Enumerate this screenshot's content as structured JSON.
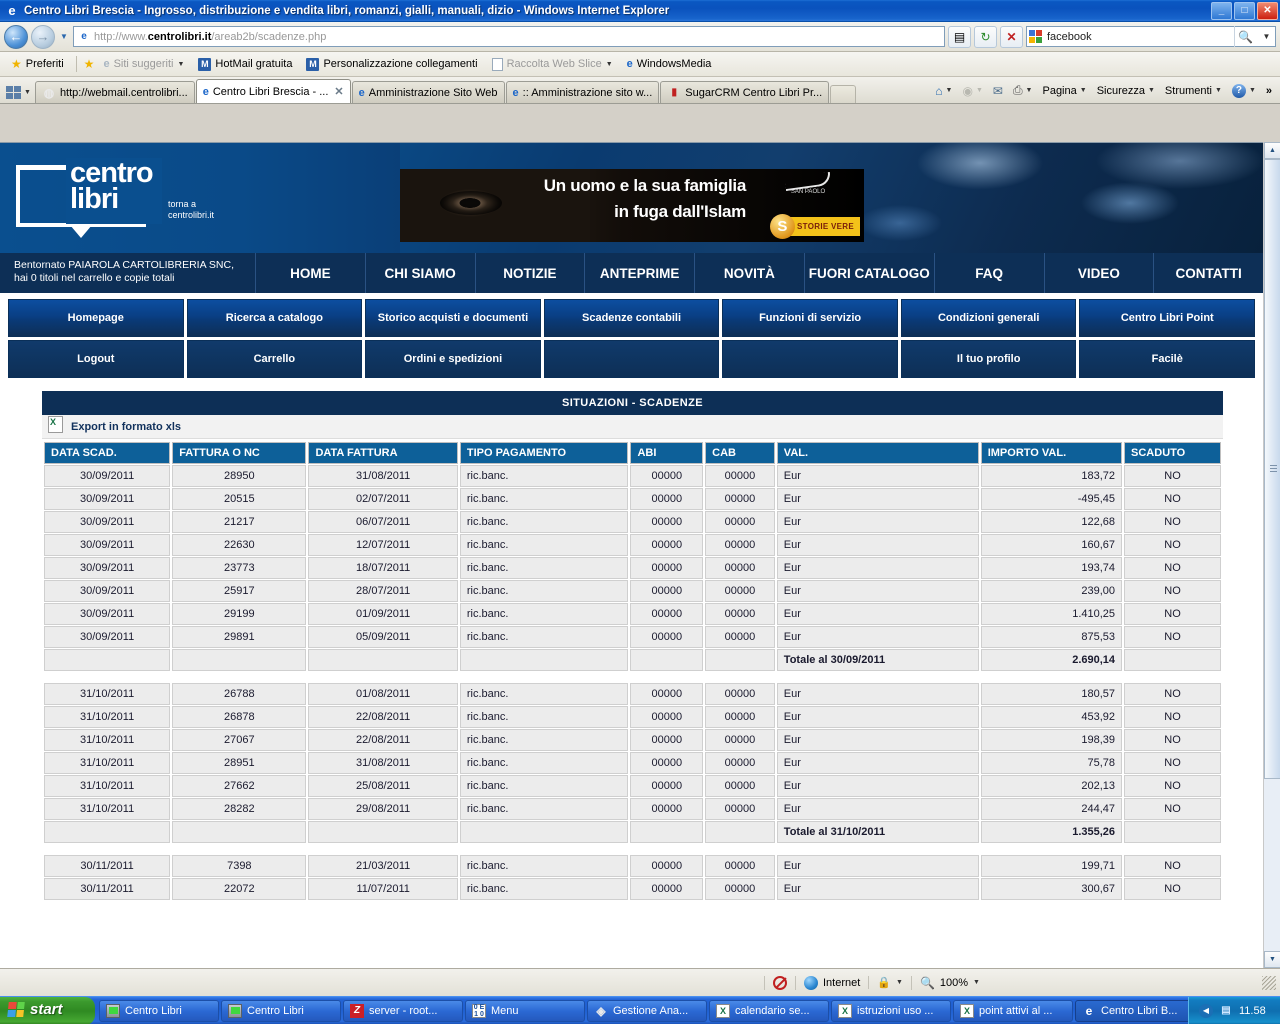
{
  "window": {
    "title": "Centro Libri Brescia - Ingrosso, distribuzione e vendita libri, romanzi, gialli, manuali, dizio - Windows Internet Explorer",
    "minimize_label": "_",
    "maximize_label": "□",
    "close_label": "✕"
  },
  "address_bar": {
    "back_icon": "back-arrow-icon",
    "forward_icon": "forward-arrow-icon",
    "url_prefix": "http://www.",
    "url_domain": "centrolibri.it",
    "url_suffix": "/areab2b/scadenze.php",
    "compat_icon": "compatibility-view-icon",
    "refresh_icon": "refresh-icon",
    "stop_icon": "stop-icon",
    "search_value": "facebook",
    "search_engine_icon": "google-icon",
    "search_go_icon": "search-icon"
  },
  "favorites_bar": {
    "favorites_label": "Preferiti",
    "items": [
      {
        "label": "Siti suggeriti",
        "icon": "ie-icon",
        "dropdown": true,
        "dimmed": true
      },
      {
        "label": "HotMail gratuita",
        "icon": "msn-icon",
        "dropdown": false,
        "dimmed": false
      },
      {
        "label": "Personalizzazione collegamenti",
        "icon": "msn-icon",
        "dropdown": false,
        "dimmed": false
      },
      {
        "label": "Raccolta Web Slice",
        "icon": "webslice-icon",
        "dropdown": true,
        "dimmed": true
      },
      {
        "label": "WindowsMedia",
        "icon": "ie-icon",
        "dropdown": false,
        "dimmed": false
      }
    ]
  },
  "tabs": [
    {
      "label": "http://webmail.centrolibri...",
      "icon": "globe-dark-icon",
      "active": false,
      "closable": false
    },
    {
      "label": "Centro Libri Brescia - ...",
      "icon": "ie-icon",
      "active": true,
      "closable": true
    },
    {
      "label": "Amministrazione Sito Web",
      "icon": "ie-icon",
      "active": false,
      "closable": false
    },
    {
      "label": ":: Amministrazione sito w...",
      "icon": "ie-icon",
      "active": false,
      "closable": false
    },
    {
      "label": "SugarCRM Centro Libri Pr...",
      "icon": "sugarcrm-icon",
      "active": false,
      "closable": false
    }
  ],
  "command_bar": {
    "home_icon": "home-icon",
    "feeds_icon": "rss-icon",
    "mail_icon": "mail-icon",
    "print_icon": "printer-icon",
    "items": [
      "Pagina",
      "Sicurezza",
      "Strumenti"
    ],
    "help_icon": "help-icon",
    "overflow_icon": "chevrons-right-icon"
  },
  "site": {
    "logo": {
      "line1": "centro",
      "line2": "libri",
      "sub_line1": "torna a",
      "sub_line2": "centrolibri.it"
    },
    "banner": {
      "line1": "Un uomo e la sua famiglia",
      "line2": "in fuga dall'Islam",
      "publisher": "SAN PAOLO",
      "series": "STORIE VERE"
    },
    "welcome": "Bentornato PAIAROLA CARTOLIBRERIA SNC, hai 0 titoli nel carrello e copie totali",
    "main_nav": [
      "HOME",
      "CHI SIAMO",
      "NOTIZIE",
      "ANTEPRIME",
      "NOVITÀ",
      "FUORI CATALOGO",
      "FAQ",
      "VIDEO",
      "CONTATTI"
    ],
    "tiles_row1": [
      "Homepage",
      "Ricerca a catalogo",
      "Storico acquisti e documenti",
      "Scadenze contabili",
      "Funzioni di servizio",
      "Condizioni generali",
      "Centro Libri Point"
    ],
    "tiles_row2": [
      "Logout",
      "Carrello",
      "Ordini e spedizioni",
      "",
      "",
      "Il tuo profilo",
      "Facilè"
    ]
  },
  "panel": {
    "title": "SITUAZIONI - SCADENZE",
    "export_label": "Export in formato xls",
    "export_icon": "excel-icon"
  },
  "table": {
    "columns": [
      "DATA SCAD.",
      "FATTURA O NC",
      "DATA FATTURA",
      "TIPO PAGAMENTO",
      "ABI",
      "CAB",
      "VAL.",
      "IMPORTO VAL.",
      "SCADUTO"
    ],
    "rows": [
      {
        "type": "data",
        "cells": [
          "30/09/2011",
          "28950",
          "31/08/2011",
          "ric.banc.",
          "00000",
          "00000",
          "Eur",
          "183,72",
          "NO"
        ],
        "negative": false
      },
      {
        "type": "data",
        "cells": [
          "30/09/2011",
          "20515",
          "02/07/2011",
          "ric.banc.",
          "00000",
          "00000",
          "Eur",
          "-495,45",
          "NO"
        ],
        "negative": true
      },
      {
        "type": "data",
        "cells": [
          "30/09/2011",
          "21217",
          "06/07/2011",
          "ric.banc.",
          "00000",
          "00000",
          "Eur",
          "122,68",
          "NO"
        ],
        "negative": false
      },
      {
        "type": "data",
        "cells": [
          "30/09/2011",
          "22630",
          "12/07/2011",
          "ric.banc.",
          "00000",
          "00000",
          "Eur",
          "160,67",
          "NO"
        ],
        "negative": false
      },
      {
        "type": "data",
        "cells": [
          "30/09/2011",
          "23773",
          "18/07/2011",
          "ric.banc.",
          "00000",
          "00000",
          "Eur",
          "193,74",
          "NO"
        ],
        "negative": false
      },
      {
        "type": "data",
        "cells": [
          "30/09/2011",
          "25917",
          "28/07/2011",
          "ric.banc.",
          "00000",
          "00000",
          "Eur",
          "239,00",
          "NO"
        ],
        "negative": false
      },
      {
        "type": "data",
        "cells": [
          "30/09/2011",
          "29199",
          "01/09/2011",
          "ric.banc.",
          "00000",
          "00000",
          "Eur",
          "1.410,25",
          "NO"
        ],
        "negative": false
      },
      {
        "type": "data",
        "cells": [
          "30/09/2011",
          "29891",
          "05/09/2011",
          "ric.banc.",
          "00000",
          "00000",
          "Eur",
          "875,53",
          "NO"
        ],
        "negative": false
      },
      {
        "type": "total",
        "label": "Totale al 30/09/2011",
        "value": "2.690,14"
      },
      {
        "type": "spacer"
      },
      {
        "type": "data",
        "cells": [
          "31/10/2011",
          "26788",
          "01/08/2011",
          "ric.banc.",
          "00000",
          "00000",
          "Eur",
          "180,57",
          "NO"
        ],
        "negative": false
      },
      {
        "type": "data",
        "cells": [
          "31/10/2011",
          "26878",
          "22/08/2011",
          "ric.banc.",
          "00000",
          "00000",
          "Eur",
          "453,92",
          "NO"
        ],
        "negative": false
      },
      {
        "type": "data",
        "cells": [
          "31/10/2011",
          "27067",
          "22/08/2011",
          "ric.banc.",
          "00000",
          "00000",
          "Eur",
          "198,39",
          "NO"
        ],
        "negative": false
      },
      {
        "type": "data",
        "cells": [
          "31/10/2011",
          "28951",
          "31/08/2011",
          "ric.banc.",
          "00000",
          "00000",
          "Eur",
          "75,78",
          "NO"
        ],
        "negative": false
      },
      {
        "type": "data",
        "cells": [
          "31/10/2011",
          "27662",
          "25/08/2011",
          "ric.banc.",
          "00000",
          "00000",
          "Eur",
          "202,13",
          "NO"
        ],
        "negative": false
      },
      {
        "type": "data",
        "cells": [
          "31/10/2011",
          "28282",
          "29/08/2011",
          "ric.banc.",
          "00000",
          "00000",
          "Eur",
          "244,47",
          "NO"
        ],
        "negative": false
      },
      {
        "type": "total",
        "label": "Totale al 31/10/2011",
        "value": "1.355,26"
      },
      {
        "type": "spacer"
      },
      {
        "type": "data",
        "cells": [
          "30/11/2011",
          "7398",
          "21/03/2011",
          "ric.banc.",
          "00000",
          "00000",
          "Eur",
          "199,71",
          "NO"
        ],
        "negative": false
      },
      {
        "type": "data",
        "cells": [
          "30/11/2011",
          "22072",
          "11/07/2011",
          "ric.banc.",
          "00000",
          "00000",
          "Eur",
          "300,67",
          "NO"
        ],
        "negative": false
      }
    ]
  },
  "status_bar": {
    "zone_label": "Internet",
    "zone_icon": "globe-icon",
    "protected_icon": "protected-mode-icon",
    "zoom_label": "100%",
    "zoom_icon": "zoom-icon",
    "blocked_icon": "popup-blocked-icon"
  },
  "taskbar": {
    "start_label": "start",
    "items": [
      {
        "label": "Centro Libri",
        "icon": "monitor-icon",
        "active": false
      },
      {
        "label": "Centro Libri",
        "icon": "monitor-icon",
        "active": false
      },
      {
        "label": "server - root...",
        "icon": "filezilla-icon",
        "active": false
      },
      {
        "label": "Menu",
        "icon": "outlook-express-icon",
        "active": false
      },
      {
        "label": "Gestione Ana...",
        "icon": "cube-icon",
        "active": false
      },
      {
        "label": "calendario se...",
        "icon": "excel-icon",
        "active": false
      },
      {
        "label": "istruzioni uso ...",
        "icon": "excel-icon",
        "active": false
      },
      {
        "label": "point attivi al ...",
        "icon": "excel-icon",
        "active": false
      },
      {
        "label": "Centro Libri B...",
        "icon": "ie-icon",
        "active": true
      }
    ],
    "clock": "11.58",
    "tray_chevron_icon": "chevron-left-icon",
    "tray_icon": "network-icon"
  }
}
